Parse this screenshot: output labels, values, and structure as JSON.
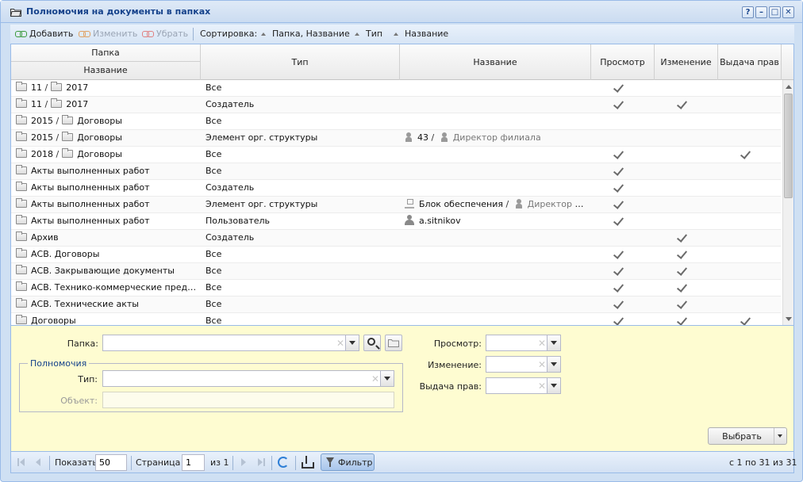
{
  "window": {
    "title": "Полномочия на документы в папках",
    "tools": [
      "?",
      "–",
      "□",
      "✕"
    ]
  },
  "toolbar": {
    "add": "Добавить",
    "edit": "Изменить",
    "remove": "Убрать",
    "sort_label": "Сортировка:",
    "sort_folder": "Папка, Название",
    "sort_type": "Тип",
    "sort_name": "Название"
  },
  "grid": {
    "header": {
      "folder": "Папка",
      "folder_name": "Название",
      "type": "Тип",
      "name": "Название",
      "view": "Просмотр",
      "change": "Изменение",
      "grant": "Выдача прав"
    },
    "rows": [
      {
        "f1": "11",
        "f2": "2017",
        "type": "Все",
        "name": "",
        "name_icon": "",
        "view": true,
        "change": false,
        "grant": false
      },
      {
        "f1": "11",
        "f2": "2017",
        "type": "Создатель",
        "name": "",
        "name_icon": "",
        "view": true,
        "change": true,
        "grant": false
      },
      {
        "f1": "2015",
        "f2": "Договоры",
        "type": "Все",
        "name": "",
        "name_icon": "",
        "view": false,
        "change": false,
        "grant": false
      },
      {
        "f1": "2015",
        "f2": "Договоры",
        "type": "Элемент орг. структуры",
        "name_a": "43",
        "name_b": "Директор филиала",
        "name_icon": "position",
        "view": false,
        "change": false,
        "grant": false
      },
      {
        "f1": "2018",
        "f2": "Договоры",
        "type": "Все",
        "name": "",
        "name_icon": "",
        "view": true,
        "change": false,
        "grant": true
      },
      {
        "f1": "Акты выполненных работ",
        "f2": "",
        "type": "Все",
        "name": "",
        "name_icon": "",
        "view": true,
        "change": false,
        "grant": false
      },
      {
        "f1": "Акты выполненных работ",
        "f2": "",
        "type": "Создатель",
        "name": "",
        "name_icon": "",
        "view": true,
        "change": false,
        "grant": false
      },
      {
        "f1": "Акты выполненных работ",
        "f2": "",
        "type": "Элемент орг. структуры",
        "name_a": "Блок обеспечения",
        "name_b": "Директор фил...",
        "name_icon": "org",
        "view": true,
        "change": false,
        "grant": false
      },
      {
        "f1": "Акты выполненных работ",
        "f2": "",
        "type": "Пользователь",
        "name": "a.sitnikov",
        "name_icon": "user",
        "view": true,
        "change": false,
        "grant": false
      },
      {
        "f1": "Архив",
        "f2": "",
        "type": "Создатель",
        "name": "",
        "name_icon": "",
        "view": false,
        "change": true,
        "grant": false
      },
      {
        "f1": "АСВ. Договоры",
        "f2": "",
        "type": "Все",
        "name": "",
        "name_icon": "",
        "view": true,
        "change": true,
        "grant": false
      },
      {
        "f1": "АСВ. Закрывающие документы",
        "f2": "",
        "type": "Все",
        "name": "",
        "name_icon": "",
        "view": true,
        "change": true,
        "grant": false
      },
      {
        "f1": "АСВ. Технико-коммерческие предлож...",
        "f2": "",
        "type": "Все",
        "name": "",
        "name_icon": "",
        "view": true,
        "change": true,
        "grant": false
      },
      {
        "f1": "АСВ. Технические акты",
        "f2": "",
        "type": "Все",
        "name": "",
        "name_icon": "",
        "view": true,
        "change": true,
        "grant": false
      },
      {
        "f1": "Договоры",
        "f2": "",
        "type": "Все",
        "name": "",
        "name_icon": "",
        "view": true,
        "change": true,
        "grant": true
      }
    ]
  },
  "filter": {
    "folder_label": "Папка:",
    "folder_value": "",
    "group_label": "Полномочия",
    "type_label": "Тип:",
    "type_value": "",
    "object_label": "Объект:",
    "view_label": "Просмотр:",
    "change_label": "Изменение:",
    "grant_label": "Выдача прав:",
    "select_button": "Выбрать"
  },
  "paging": {
    "show_label": "Показать",
    "page_size": "50",
    "page_label": "Страница",
    "page": "1",
    "of_label": "из 1",
    "filter_button": "Фильтр",
    "summary": "с 1 по 31 из 31"
  }
}
